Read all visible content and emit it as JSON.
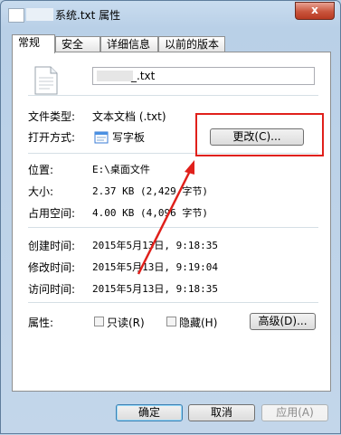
{
  "window": {
    "title": "系统.txt 属性",
    "close_label": "x"
  },
  "tabs": [
    {
      "label": "常规"
    },
    {
      "label": "安全"
    },
    {
      "label": "详细信息"
    },
    {
      "label": "以前的版本"
    }
  ],
  "file": {
    "name": "_.txt"
  },
  "props": {
    "type_label": "文件类型:",
    "type_value": "文本文档 (.txt)",
    "open_label": "打开方式:",
    "open_value": "写字板",
    "change_button": "更改(C)...",
    "location_label": "位置:",
    "location_value": "E:\\桌面文件",
    "size_label": "大小:",
    "size_value": "2.37 KB (2,429 字节)",
    "disk_label": "占用空间:",
    "disk_value": "4.00 KB (4,096 字节)",
    "created_label": "创建时间:",
    "created_value": "2015年5月13日, 9:18:35",
    "modified_label": "修改时间:",
    "modified_value": "2015年5月13日, 9:19:04",
    "accessed_label": "访问时间:",
    "accessed_value": "2015年5月13日, 9:18:35",
    "attr_label": "属性:",
    "readonly_label": "只读(R)",
    "hidden_label": "隐藏(H)",
    "advanced_button": "高级(D)..."
  },
  "footer": {
    "ok": "确定",
    "cancel": "取消",
    "apply": "应用(A)"
  },
  "annotation_color": "#e0201b"
}
